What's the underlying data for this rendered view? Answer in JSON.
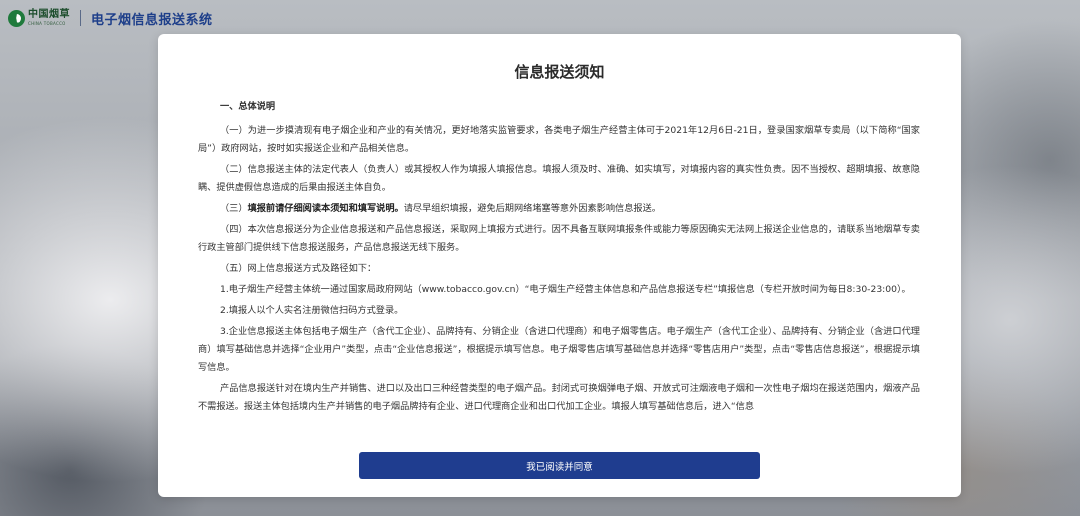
{
  "header": {
    "logo_cn": "中国烟草",
    "logo_en": "CHINA TOBACCO",
    "system_title": "电子烟信息报送系统"
  },
  "notice": {
    "title": "信息报送须知",
    "section_heading": "一、总体说明",
    "para1": "（一）为进一步摸清现有电子烟企业和产业的有关情况，更好地落实监管要求，各类电子烟生产经营主体可于2021年12月6日-21日，登录国家烟草专卖局（以下简称“国家局”）政府网站，按时如实报送企业和产品相关信息。",
    "para2": "（二）信息报送主体的法定代表人（负责人）或其授权人作为填报人填报信息。填报人须及时、准确、如实填写，对填报内容的真实性负责。因不当授权、超期填报、故意隐瞒、提供虚假信息造成的后果由报送主体自负。",
    "para3_prefix": "（三）",
    "para3_bold": "填报前请仔细阅读本须知和填写说明。",
    "para3_rest": "请尽早组织填报，避免后期网络堵塞等意外因素影响信息报送。",
    "para4": "（四）本次信息报送分为企业信息报送和产品信息报送，采取网上填报方式进行。因不具备互联网填报条件或能力等原因确实无法网上报送企业信息的，请联系当地烟草专卖行政主管部门提供线下信息报送服务，产品信息报送无线下服务。",
    "para5": "（五）网上信息报送方式及路径如下：",
    "item1": "1.电子烟生产经营主体统一通过国家局政府网站（www.tobacco.gov.cn）“电子烟生产经营主体信息和产品信息报送专栏”填报信息（专栏开放时间为每日8:30-23:00）。",
    "item2": "2.填报人以个人实名注册微信扫码方式登录。",
    "item3": "3.企业信息报送主体包括电子烟生产（含代工企业）、品牌持有、分销企业（含进口代理商）和电子烟零售店。电子烟生产（含代工企业）、品牌持有、分销企业（含进口代理商）填写基础信息并选择“企业用户”类型，点击“企业信息报送”，根据提示填写信息。电子烟零售店填写基础信息并选择“零售店用户”类型，点击“零售店信息报送”，根据提示填写信息。",
    "para6": "产品信息报送针对在境内生产并销售、进口以及出口三种经营类型的电子烟产品。封闭式可换烟弹电子烟、开放式可注烟液电子烟和一次性电子烟均在报送范围内，烟液产品不需报送。报送主体包括境内生产并销售的电子烟品牌持有企业、进口代理商企业和出口代加工企业。填报人填写基础信息后，进入“信息"
  },
  "actions": {
    "agree_label": "我已阅读并同意"
  },
  "colors": {
    "brand_blue": "#1f3d8f",
    "logo_green": "#1f7a3c"
  }
}
